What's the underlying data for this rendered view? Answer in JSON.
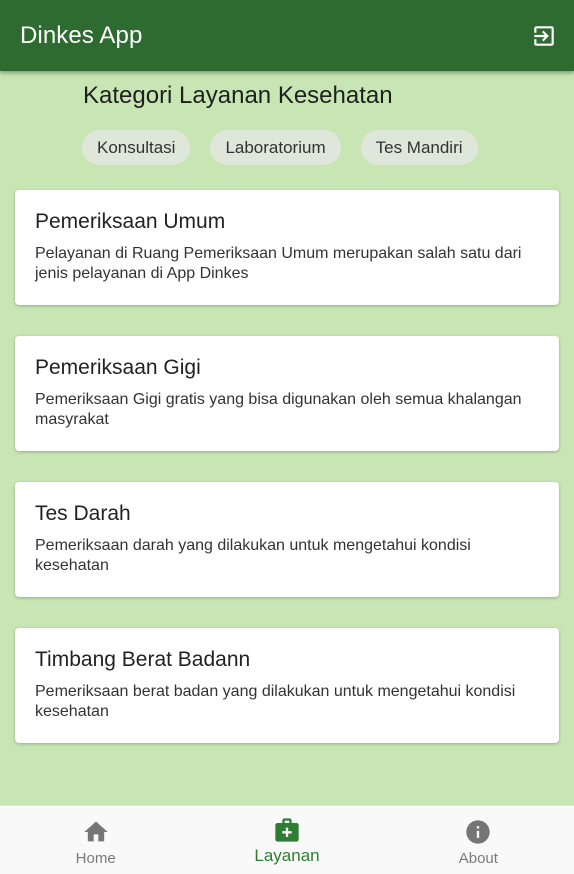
{
  "app_bar": {
    "title": "Dinkes App",
    "logout_icon": "logout-icon"
  },
  "category": {
    "title": "Kategori Layanan Kesehatan",
    "chips": [
      "Konsultasi",
      "Laboratorium",
      "Tes Mandiri"
    ]
  },
  "services": [
    {
      "title": "Pemeriksaan Umum",
      "description": "Pelayanan di Ruang Pemeriksaan Umum merupakan salah satu dari jenis pelayanan di App Dinkes"
    },
    {
      "title": "Pemeriksaan Gigi",
      "description": "Pemeriksaan Gigi gratis yang bisa digunakan oleh semua khalangan masyrakat"
    },
    {
      "title": "Tes Darah",
      "description": "Pemeriksaan darah yang dilakukan untuk mengetahui kondisi kesehatan"
    },
    {
      "title": "Timbang Berat Badann",
      "description": "Pemeriksaan berat badan yang dilakukan untuk mengetahui kondisi kesehatan"
    }
  ],
  "bottom_nav": {
    "items": [
      {
        "label": "Home",
        "icon": "home-icon",
        "active": false
      },
      {
        "label": "Layanan",
        "icon": "medical-bag-icon",
        "active": true
      },
      {
        "label": "About",
        "icon": "info-icon",
        "active": false
      }
    ]
  },
  "colors": {
    "app_bar": "#2e6b30",
    "background": "#c8e6b3",
    "chip": "#dfe6da",
    "active_nav": "#2e7d32",
    "inactive_nav": "#7a7a7a"
  }
}
